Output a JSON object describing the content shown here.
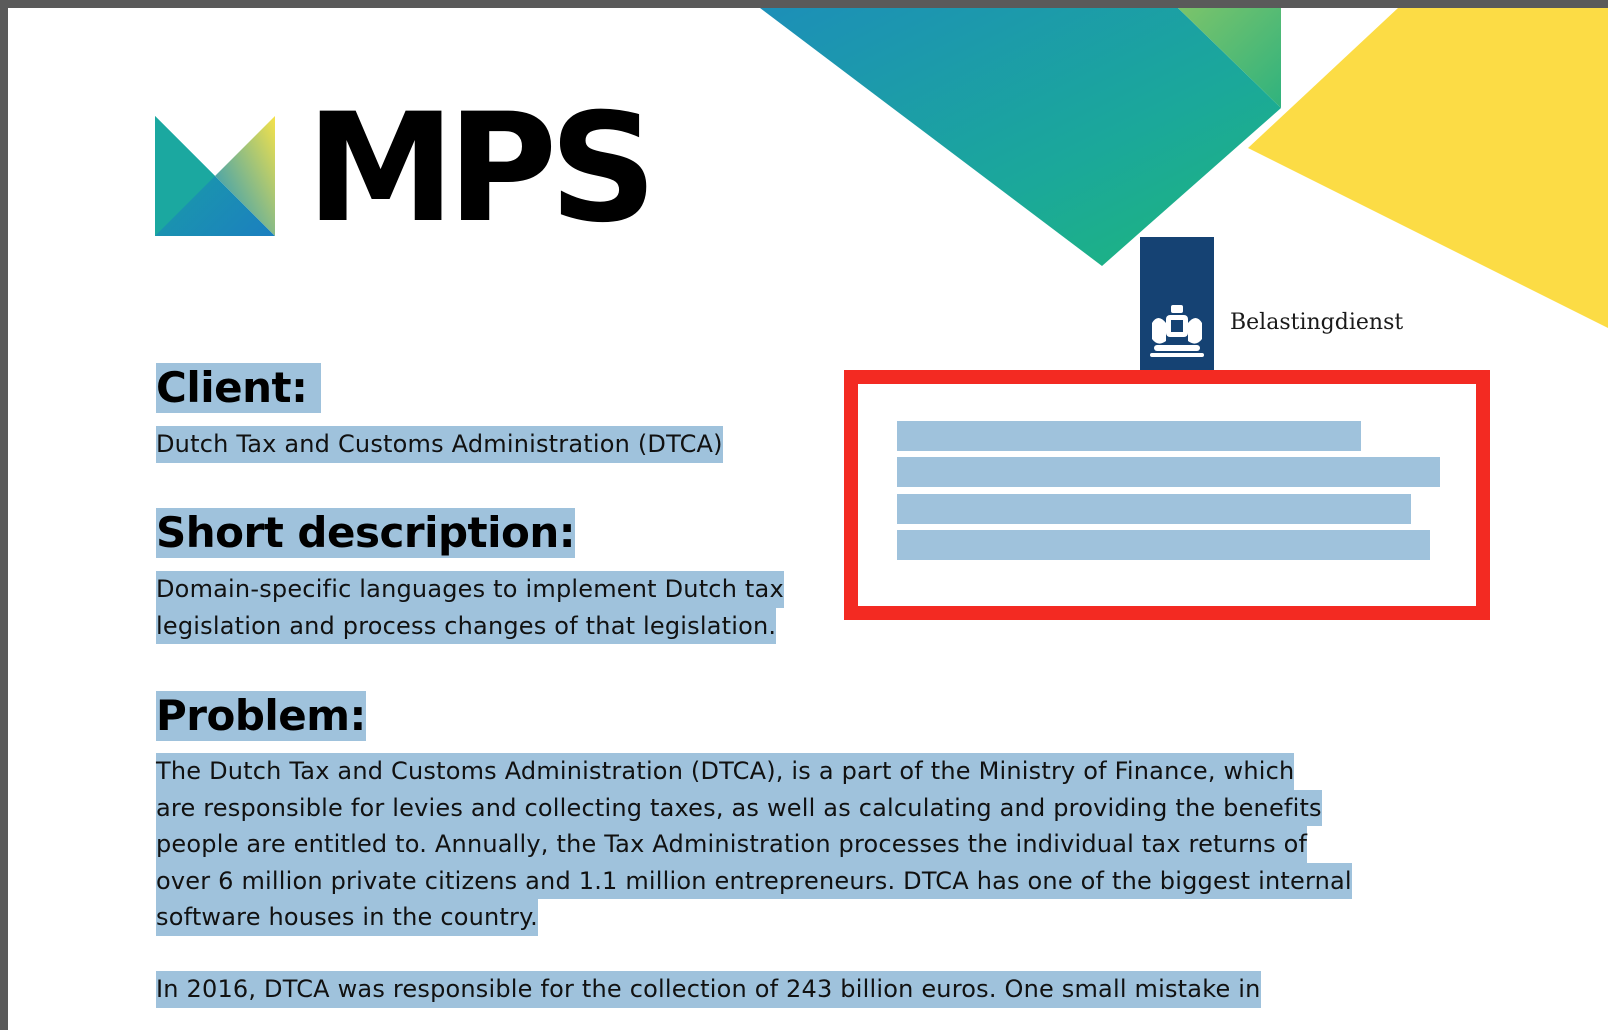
{
  "logo": {
    "text": "MPS"
  },
  "partner_logo": {
    "name": "Belastingdienst"
  },
  "sections": {
    "client": {
      "heading": "Client:",
      "text": "Dutch Tax and Customs Administration (DTCA)"
    },
    "short_description": {
      "heading": "Short description:",
      "lines": [
        "Domain-specific languages to implement Dutch tax",
        "legislation and process changes of that legislation."
      ]
    },
    "problem": {
      "heading": "Problem:",
      "paragraph1": [
        "The Dutch Tax and Customs Administration (DTCA), is a part of the Ministry of Finance, which",
        "are responsible for levies and collecting taxes, as well as calculating and providing the benefits",
        "people are entitled to. Annually, the Tax Administration processes the individual tax returns of",
        "over 6 million private citizens and 1.1 million entrepreneurs. DTCA has one of the biggest internal",
        "software houses in the country."
      ],
      "paragraph2": [
        "In 2016, DTCA was responsible for the collection of 243 billion euros. One small mistake in"
      ]
    }
  },
  "colors": {
    "selection": "#9fc2dc",
    "highlight_box": "#f32a22",
    "belastingdienst_blue": "#154273",
    "accent_teal": "#1a9aa8",
    "accent_green": "#1db37a",
    "accent_yellow": "#fcdc45"
  }
}
